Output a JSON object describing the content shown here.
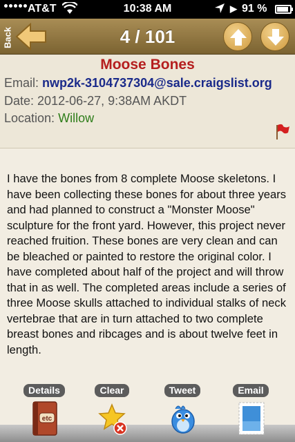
{
  "status": {
    "carrier": "AT&T",
    "time": "10:38 AM",
    "battery": "91 %",
    "battery_level": 0.91
  },
  "nav": {
    "back_label": "Back",
    "counter": "4 / 101"
  },
  "post": {
    "title": "Moose Bones",
    "email_label": "Email:",
    "email": "nwp2k-3104737304@sale.craigslist.org",
    "date_label": "Date:",
    "date": "2012-06-27,  9:38AM AKDT",
    "location_label": "Location:",
    "location": "Willow",
    "body": "I have the bones from 8 complete Moose skeletons. I have been collecting these bones for about three years and had planned to construct a \"Monster Moose\" sculpture for the front yard. However, this project never reached fruition. These bones are very clean and can be bleached or painted to restore the original color. I have completed about half of the project and will throw that in as well. The completed areas include a series of three Moose skulls attached to individual stalks of neck vertebrae that are in turn attached to two complete breast bones and ribcages and is about twelve feet in length."
  },
  "toolbar": {
    "details_label": "Details",
    "clear_label": "Clear",
    "tweet_label": "Tweet",
    "email_label": "Email",
    "details_icon_text": "etc"
  },
  "colors": {
    "nav_bar": "#8f7640",
    "title": "#b51e1e",
    "email_link": "#1a2a8a",
    "location": "#2e7d1a",
    "flag": "#d42020"
  }
}
